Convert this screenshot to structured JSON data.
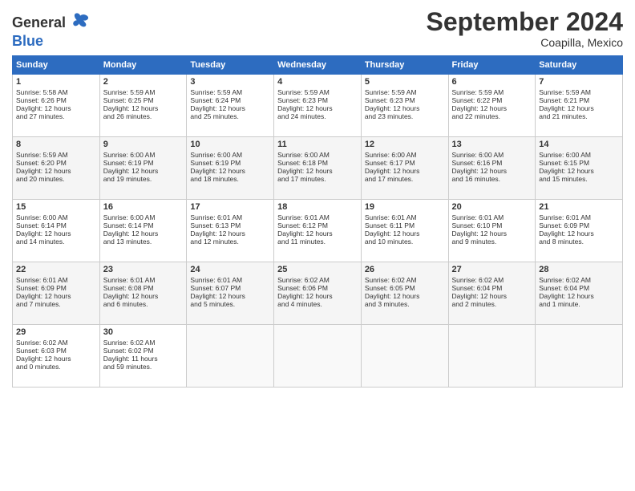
{
  "header": {
    "logo_text_general": "General",
    "logo_text_blue": "Blue",
    "month": "September 2024",
    "location": "Coapilla, Mexico"
  },
  "weekdays": [
    "Sunday",
    "Monday",
    "Tuesday",
    "Wednesday",
    "Thursday",
    "Friday",
    "Saturday"
  ],
  "weeks": [
    [
      {
        "day": "1",
        "lines": [
          "Sunrise: 5:58 AM",
          "Sunset: 6:26 PM",
          "Daylight: 12 hours",
          "and 27 minutes."
        ]
      },
      {
        "day": "2",
        "lines": [
          "Sunrise: 5:59 AM",
          "Sunset: 6:25 PM",
          "Daylight: 12 hours",
          "and 26 minutes."
        ]
      },
      {
        "day": "3",
        "lines": [
          "Sunrise: 5:59 AM",
          "Sunset: 6:24 PM",
          "Daylight: 12 hours",
          "and 25 minutes."
        ]
      },
      {
        "day": "4",
        "lines": [
          "Sunrise: 5:59 AM",
          "Sunset: 6:23 PM",
          "Daylight: 12 hours",
          "and 24 minutes."
        ]
      },
      {
        "day": "5",
        "lines": [
          "Sunrise: 5:59 AM",
          "Sunset: 6:23 PM",
          "Daylight: 12 hours",
          "and 23 minutes."
        ]
      },
      {
        "day": "6",
        "lines": [
          "Sunrise: 5:59 AM",
          "Sunset: 6:22 PM",
          "Daylight: 12 hours",
          "and 22 minutes."
        ]
      },
      {
        "day": "7",
        "lines": [
          "Sunrise: 5:59 AM",
          "Sunset: 6:21 PM",
          "Daylight: 12 hours",
          "and 21 minutes."
        ]
      }
    ],
    [
      {
        "day": "8",
        "lines": [
          "Sunrise: 5:59 AM",
          "Sunset: 6:20 PM",
          "Daylight: 12 hours",
          "and 20 minutes."
        ]
      },
      {
        "day": "9",
        "lines": [
          "Sunrise: 6:00 AM",
          "Sunset: 6:19 PM",
          "Daylight: 12 hours",
          "and 19 minutes."
        ]
      },
      {
        "day": "10",
        "lines": [
          "Sunrise: 6:00 AM",
          "Sunset: 6:19 PM",
          "Daylight: 12 hours",
          "and 18 minutes."
        ]
      },
      {
        "day": "11",
        "lines": [
          "Sunrise: 6:00 AM",
          "Sunset: 6:18 PM",
          "Daylight: 12 hours",
          "and 17 minutes."
        ]
      },
      {
        "day": "12",
        "lines": [
          "Sunrise: 6:00 AM",
          "Sunset: 6:17 PM",
          "Daylight: 12 hours",
          "and 17 minutes."
        ]
      },
      {
        "day": "13",
        "lines": [
          "Sunrise: 6:00 AM",
          "Sunset: 6:16 PM",
          "Daylight: 12 hours",
          "and 16 minutes."
        ]
      },
      {
        "day": "14",
        "lines": [
          "Sunrise: 6:00 AM",
          "Sunset: 6:15 PM",
          "Daylight: 12 hours",
          "and 15 minutes."
        ]
      }
    ],
    [
      {
        "day": "15",
        "lines": [
          "Sunrise: 6:00 AM",
          "Sunset: 6:14 PM",
          "Daylight: 12 hours",
          "and 14 minutes."
        ]
      },
      {
        "day": "16",
        "lines": [
          "Sunrise: 6:00 AM",
          "Sunset: 6:14 PM",
          "Daylight: 12 hours",
          "and 13 minutes."
        ]
      },
      {
        "day": "17",
        "lines": [
          "Sunrise: 6:01 AM",
          "Sunset: 6:13 PM",
          "Daylight: 12 hours",
          "and 12 minutes."
        ]
      },
      {
        "day": "18",
        "lines": [
          "Sunrise: 6:01 AM",
          "Sunset: 6:12 PM",
          "Daylight: 12 hours",
          "and 11 minutes."
        ]
      },
      {
        "day": "19",
        "lines": [
          "Sunrise: 6:01 AM",
          "Sunset: 6:11 PM",
          "Daylight: 12 hours",
          "and 10 minutes."
        ]
      },
      {
        "day": "20",
        "lines": [
          "Sunrise: 6:01 AM",
          "Sunset: 6:10 PM",
          "Daylight: 12 hours",
          "and 9 minutes."
        ]
      },
      {
        "day": "21",
        "lines": [
          "Sunrise: 6:01 AM",
          "Sunset: 6:09 PM",
          "Daylight: 12 hours",
          "and 8 minutes."
        ]
      }
    ],
    [
      {
        "day": "22",
        "lines": [
          "Sunrise: 6:01 AM",
          "Sunset: 6:09 PM",
          "Daylight: 12 hours",
          "and 7 minutes."
        ]
      },
      {
        "day": "23",
        "lines": [
          "Sunrise: 6:01 AM",
          "Sunset: 6:08 PM",
          "Daylight: 12 hours",
          "and 6 minutes."
        ]
      },
      {
        "day": "24",
        "lines": [
          "Sunrise: 6:01 AM",
          "Sunset: 6:07 PM",
          "Daylight: 12 hours",
          "and 5 minutes."
        ]
      },
      {
        "day": "25",
        "lines": [
          "Sunrise: 6:02 AM",
          "Sunset: 6:06 PM",
          "Daylight: 12 hours",
          "and 4 minutes."
        ]
      },
      {
        "day": "26",
        "lines": [
          "Sunrise: 6:02 AM",
          "Sunset: 6:05 PM",
          "Daylight: 12 hours",
          "and 3 minutes."
        ]
      },
      {
        "day": "27",
        "lines": [
          "Sunrise: 6:02 AM",
          "Sunset: 6:04 PM",
          "Daylight: 12 hours",
          "and 2 minutes."
        ]
      },
      {
        "day": "28",
        "lines": [
          "Sunrise: 6:02 AM",
          "Sunset: 6:04 PM",
          "Daylight: 12 hours",
          "and 1 minute."
        ]
      }
    ],
    [
      {
        "day": "29",
        "lines": [
          "Sunrise: 6:02 AM",
          "Sunset: 6:03 PM",
          "Daylight: 12 hours",
          "and 0 minutes."
        ]
      },
      {
        "day": "30",
        "lines": [
          "Sunrise: 6:02 AM",
          "Sunset: 6:02 PM",
          "Daylight: 11 hours",
          "and 59 minutes."
        ]
      },
      {
        "day": "",
        "lines": []
      },
      {
        "day": "",
        "lines": []
      },
      {
        "day": "",
        "lines": []
      },
      {
        "day": "",
        "lines": []
      },
      {
        "day": "",
        "lines": []
      }
    ]
  ]
}
